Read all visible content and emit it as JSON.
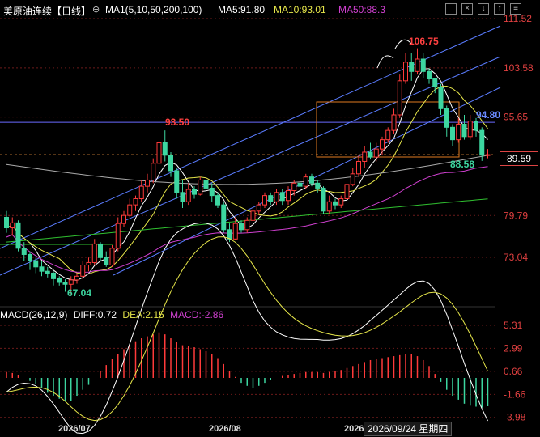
{
  "header": {
    "title": "美原油连续",
    "period": "【日线】",
    "ma_title": "MA1(5,10,50,200,100)",
    "ma5": "MA5:91.80",
    "ma10": "MA10:93.01",
    "ma50": "MA50:88.3",
    "colors": {
      "ma5": "#ffffff",
      "ma10": "#e6e64a",
      "ma50": "#d040d0",
      "ma200": "#30c030",
      "ma100": "#aaaaaa"
    },
    "icons": [
      "toggle-circle-icon",
      "checkbox-icon",
      "close-box-icon",
      "arrow-down-box-icon",
      "arrow-up-box-icon",
      "settings-box-icon"
    ]
  },
  "price_axis": [
    "111.52",
    "103.58",
    "95.65",
    "89.59",
    "79.79",
    "73.04"
  ],
  "annotations": {
    "high": "106.75",
    "low": "67.04",
    "swing_high": "93.50",
    "line_level": "94.80",
    "recent_low": "88.58"
  },
  "current_price": "89.59",
  "macd": {
    "title": "MACD(26,12,9)",
    "diff": "DIFF:0.72",
    "dea": "DEA:2.15",
    "macd": "MACD:-2.86",
    "axis": [
      "5.31",
      "2.99",
      "0.66",
      "-1.66",
      "-3.98"
    ]
  },
  "x_axis": [
    "2026/07",
    "2026/08",
    "2026"
  ],
  "crosshair_date": "2026/09/24 星期四",
  "chart_data": {
    "type": "candlestick",
    "candles": [
      [
        79.5,
        77.8,
        80.5,
        77.0
      ],
      [
        77.8,
        78.6,
        79.5,
        76.5
      ],
      [
        78.6,
        74.5,
        79.0,
        74.0
      ],
      [
        74.5,
        73.5,
        75.5,
        72.5
      ],
      [
        73.5,
        72.5,
        74.0,
        71.0
      ],
      [
        72.5,
        71.5,
        73.0,
        70.5
      ],
      [
        71.5,
        70.8,
        72.5,
        70.0
      ],
      [
        70.8,
        70.5,
        71.5,
        69.8
      ],
      [
        70.5,
        69.6,
        70.8,
        68.5
      ],
      [
        69.6,
        69.0,
        70.0,
        68.5
      ],
      [
        69.0,
        68.7,
        69.5,
        67.5
      ],
      [
        68.7,
        69.4,
        70.0,
        67.04
      ],
      [
        69.4,
        70.0,
        70.5,
        68.8
      ],
      [
        70.0,
        71.8,
        72.5,
        69.5
      ],
      [
        71.8,
        72.2,
        73.0,
        70.8
      ],
      [
        72.2,
        75.2,
        76.0,
        71.8
      ],
      [
        75.2,
        73.0,
        75.5,
        72.5
      ],
      [
        73.0,
        71.8,
        74.0,
        71.5
      ],
      [
        71.8,
        74.5,
        75.0,
        71.5
      ],
      [
        74.5,
        78.5,
        79.5,
        74.0
      ],
      [
        78.5,
        79.8,
        80.5,
        78.0
      ],
      [
        79.8,
        81.5,
        82.5,
        79.5
      ],
      [
        81.5,
        82.5,
        83.0,
        80.5
      ],
      [
        82.5,
        84.5,
        85.5,
        82.0
      ],
      [
        84.5,
        85.5,
        86.5,
        83.5
      ],
      [
        85.5,
        88.2,
        89.0,
        85.0
      ],
      [
        88.2,
        91.5,
        93.0,
        87.5
      ],
      [
        91.5,
        89.5,
        93.5,
        88.5
      ],
      [
        89.5,
        87.0,
        90.0,
        86.0
      ],
      [
        87.0,
        83.5,
        87.5,
        82.5
      ],
      [
        83.5,
        82.0,
        85.5,
        81.0
      ],
      [
        82.0,
        84.0,
        85.0,
        81.5
      ],
      [
        84.0,
        83.2,
        84.5,
        82.5
      ],
      [
        83.2,
        85.5,
        86.0,
        83.0
      ],
      [
        85.5,
        84.2,
        86.5,
        83.5
      ],
      [
        84.2,
        83.0,
        85.0,
        82.0
      ],
      [
        83.0,
        81.5,
        83.5,
        81.0
      ],
      [
        81.5,
        77.5,
        82.0,
        77.0
      ],
      [
        77.5,
        76.0,
        78.5,
        75.5
      ],
      [
        76.0,
        78.5,
        79.5,
        75.8
      ],
      [
        78.5,
        77.5,
        79.0,
        77.0
      ],
      [
        77.5,
        79.0,
        79.5,
        77.0
      ],
      [
        79.0,
        80.5,
        81.0,
        78.5
      ],
      [
        80.5,
        81.5,
        82.0,
        80.0
      ],
      [
        81.5,
        83.0,
        83.5,
        81.0
      ],
      [
        83.0,
        82.0,
        83.5,
        81.5
      ],
      [
        82.0,
        83.5,
        84.0,
        81.5
      ],
      [
        83.5,
        82.2,
        84.0,
        81.5
      ],
      [
        82.2,
        83.8,
        84.5,
        81.5
      ],
      [
        83.8,
        85.0,
        85.5,
        83.0
      ],
      [
        85.0,
        84.5,
        86.0,
        84.0
      ],
      [
        84.5,
        86.0,
        86.5,
        84.0
      ],
      [
        86.0,
        85.0,
        86.5,
        84.5
      ],
      [
        85.0,
        84.2,
        85.5,
        83.5
      ],
      [
        84.2,
        80.5,
        84.5,
        80.0
      ],
      [
        80.5,
        82.0,
        83.0,
        80.0
      ],
      [
        82.0,
        81.5,
        82.5,
        80.8
      ],
      [
        81.5,
        82.5,
        83.0,
        81.0
      ],
      [
        82.5,
        84.8,
        85.5,
        82.0
      ],
      [
        84.8,
        86.5,
        87.5,
        84.5
      ],
      [
        86.5,
        88.5,
        89.5,
        86.0
      ],
      [
        88.5,
        90.0,
        91.0,
        87.5
      ],
      [
        90.0,
        89.2,
        91.5,
        88.8
      ],
      [
        89.2,
        90.5,
        91.5,
        88.5
      ],
      [
        90.5,
        92.0,
        92.5,
        89.5
      ],
      [
        92.0,
        93.5,
        94.0,
        91.5
      ],
      [
        93.5,
        96.0,
        97.0,
        93.0
      ],
      [
        96.0,
        101.5,
        102.5,
        95.5
      ],
      [
        101.5,
        104.5,
        106.0,
        101.0
      ],
      [
        104.5,
        103.0,
        106.0,
        101.5
      ],
      [
        103.0,
        105.0,
        106.75,
        102.5
      ],
      [
        105.0,
        103.0,
        106.0,
        102.0
      ],
      [
        103.0,
        101.8,
        103.5,
        101.0
      ],
      [
        101.8,
        100.5,
        102.0,
        99.5
      ],
      [
        100.5,
        97.0,
        101.0,
        96.0
      ],
      [
        97.0,
        94.0,
        97.5,
        92.5
      ],
      [
        94.0,
        92.0,
        94.5,
        91.0
      ],
      [
        92.0,
        94.5,
        95.5,
        91.5
      ],
      [
        94.5,
        92.5,
        96.0,
        92.0
      ],
      [
        92.5,
        95.0,
        96.0,
        92.0
      ],
      [
        95.0,
        93.5,
        95.5,
        92.5
      ],
      [
        93.5,
        89.5,
        94.0,
        88.58
      ],
      [
        89.5,
        89.59,
        90.5,
        89.0
      ]
    ],
    "macd_hist": [
      0.6,
      0.5,
      0.3,
      0.0,
      -0.3,
      -0.6,
      -1.0,
      -1.5,
      -1.8,
      -2.1,
      -2.3,
      -2.3,
      -1.8,
      -1.2,
      -0.7,
      0.0,
      0.7,
      1.3,
      1.9,
      2.4,
      2.9,
      3.3,
      3.7,
      4.0,
      4.2,
      4.4,
      4.6,
      4.4,
      4.0,
      3.6,
      3.3,
      3.2,
      3.1,
      2.9,
      2.7,
      2.4,
      2.0,
      1.4,
      0.7,
      0.1,
      -0.5,
      -0.8,
      -1.0,
      -0.8,
      -0.5,
      -0.2,
      0.0,
      0.2,
      0.3,
      0.4,
      0.5,
      0.6,
      0.6,
      0.6,
      0.5,
      0.6,
      0.7,
      0.8,
      1.0,
      1.2,
      1.4,
      1.6,
      1.8,
      1.9,
      2.0,
      2.1,
      2.2,
      2.3,
      2.4,
      2.4,
      2.2,
      1.8,
      1.2,
      0.4,
      -0.4,
      -1.2,
      -1.8,
      -2.2,
      -2.6,
      -2.8,
      -2.9,
      -3.0,
      -2.86
    ],
    "ylim": [
      65,
      114
    ],
    "macd_ylim": [
      -5,
      6.5
    ]
  }
}
